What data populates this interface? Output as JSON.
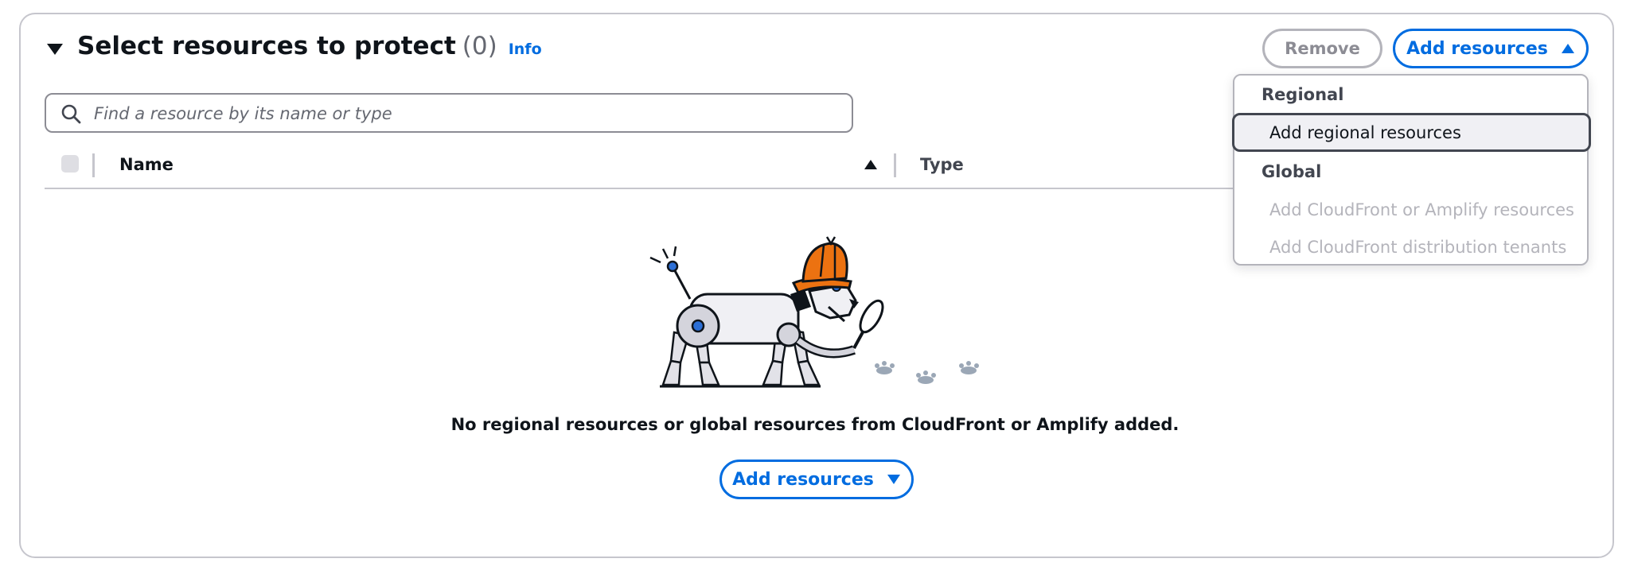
{
  "header": {
    "title": "Select resources to protect",
    "count": "(0)",
    "info_link": "Info",
    "remove_label": "Remove",
    "add_resources_label": "Add resources"
  },
  "search": {
    "placeholder": "Find a resource by its name or type",
    "value": ""
  },
  "table": {
    "columns": [
      "Name",
      "Type"
    ],
    "sort": {
      "column": "Name",
      "direction": "ascending"
    },
    "rows": []
  },
  "empty_state": {
    "message": "No regional resources or global resources from CloudFront or Amplify added.",
    "add_resources_label": "Add resources",
    "illustration": "robot-dog-detective-icon"
  },
  "dropdown": {
    "open": true,
    "groups": [
      {
        "label": "Regional",
        "items": [
          {
            "label": "Add regional resources",
            "state": "highlighted"
          }
        ]
      },
      {
        "label": "Global",
        "items": [
          {
            "label": "Add CloudFront or Amplify resources",
            "state": "disabled"
          },
          {
            "label": "Add CloudFront distribution tenants",
            "state": "disabled"
          }
        ]
      }
    ]
  },
  "colors": {
    "link": "#006ce0",
    "border": "#c6c6cd",
    "text": "#0f141a",
    "disabled": "#b4b4bb",
    "hat": "#ec7211"
  },
  "icons": {
    "collapse_toggle": "caret-down-icon",
    "search": "search-icon",
    "dropdown_open": "caret-up-icon",
    "dropdown_closed": "caret-down-icon",
    "sort": "sort-ascending-icon"
  }
}
